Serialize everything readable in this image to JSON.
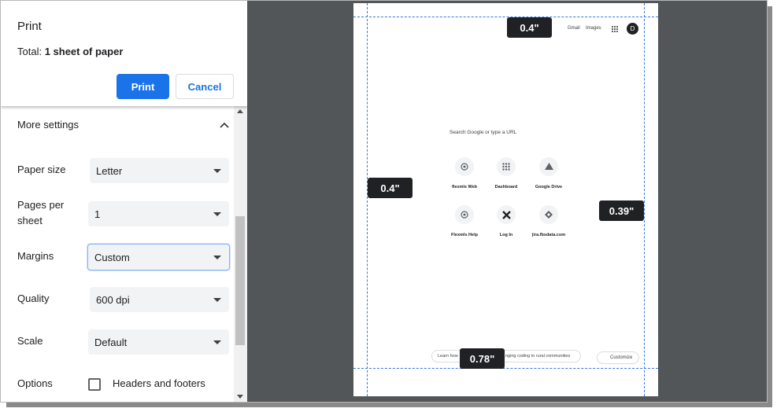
{
  "header": {
    "title": "Print",
    "total_prefix": "Total: ",
    "total_value": "1 sheet of paper",
    "print_label": "Print",
    "cancel_label": "Cancel"
  },
  "settings": {
    "more_settings_label": "More settings",
    "rows": [
      {
        "label": "Paper size",
        "value": "Letter"
      },
      {
        "label_line1": "Pages per",
        "label_line2": "sheet",
        "value": "1"
      },
      {
        "label": "Margins",
        "value": "Custom"
      },
      {
        "label": "Quality",
        "value": "600 dpi"
      },
      {
        "label": "Scale",
        "value": "Default"
      }
    ],
    "options_label": "Options",
    "headers_footers_label": "Headers and footers",
    "headers_footers_checked": false
  },
  "preview": {
    "top_links": [
      "Gmail",
      "Images"
    ],
    "avatar_letter": "D",
    "search_placeholder": "Search Google or type a URL",
    "shortcuts": [
      {
        "label": "flexmls Web",
        "icon": "flexmls-icon"
      },
      {
        "label": "Dashboard",
        "icon": "dashboard-icon"
      },
      {
        "label": "Google Drive",
        "icon": "google-drive-icon"
      },
      {
        "label": "Flexmls Help",
        "icon": "flexmls-help-icon"
      },
      {
        "label": "Log In",
        "icon": "login-icon"
      },
      {
        "label": "jira.fbsdata.com",
        "icon": "jira-icon"
      }
    ],
    "footer_left": "Learn how",
    "footer_middle": "nging coding to rural communities",
    "customize_label": "Customize",
    "margins": {
      "top": "0.4\"",
      "left": "0.4\"",
      "right": "0.39\"",
      "bottom": "0.78\""
    }
  },
  "colors": {
    "accent": "#1a73e8",
    "preview_bg": "#525659",
    "guide": "#3b78d8",
    "badge": "#202124"
  }
}
